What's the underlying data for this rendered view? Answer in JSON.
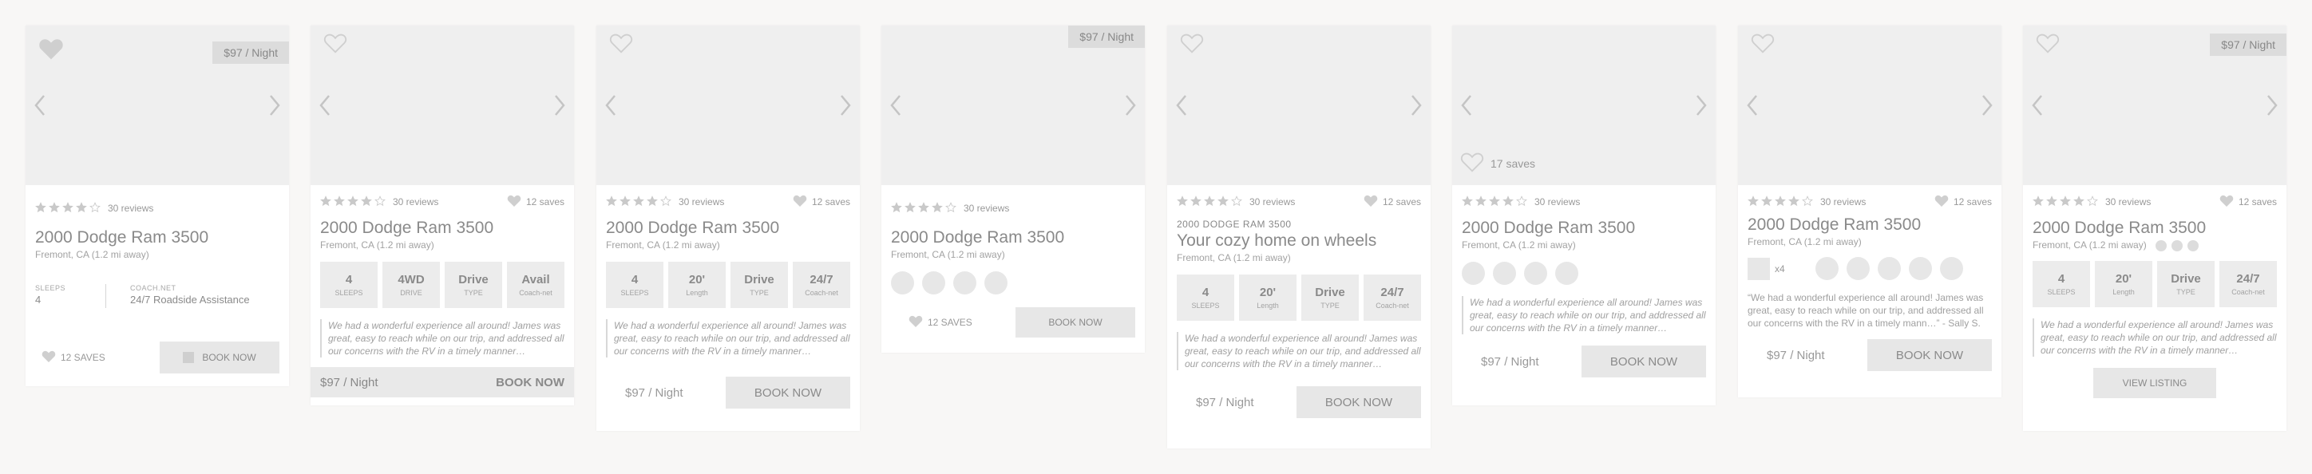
{
  "listing": {
    "price_tag": "$97 / Night",
    "reviews": "30 reviews",
    "saves": "12 saves",
    "photo_saves": "17 saves",
    "title": "2000 Dodge Ram 3500",
    "location": "Fremont, CA (1.2 mi away)",
    "eyebrow": "2000 DODGE RAM 3500",
    "cozy_title": "Your cozy home on wheels",
    "review": "We had a wonderful experience all around! James was great, easy to reach while on our trip, and addressed all our concerns with the RV in a timely manner…",
    "review_quoted": "“We had a wonderful experience all around! James was great, easy to reach while on our trip, and addressed all our concerns with the RV in a timely mann…”",
    "review_author": " - Sally S.",
    "price_text": "$97 / Night",
    "book_now": "BOOK NOW",
    "book_now_title": "Book Now",
    "saves_upper": "12 SAVES",
    "view_listing": "VIEW LISTING",
    "x4": "x4"
  },
  "card1": {
    "sleeps_label": "SLEEPS",
    "sleeps_value": "4",
    "coach_label": "COACH.NET",
    "coach_value": "24/7 Roadside Assistance"
  },
  "specs_a": [
    {
      "value": "4",
      "label": "SLEEPS"
    },
    {
      "value": "4WD",
      "label": "DRIVE"
    },
    {
      "value": "Drive",
      "label": "TYPE"
    },
    {
      "value": "Avail",
      "label": "Coach-net"
    }
  ],
  "specs_b": [
    {
      "value": "4",
      "label": "SLEEPS"
    },
    {
      "value": "20'",
      "label": "Length"
    },
    {
      "value": "Drive",
      "label": "TYPE"
    },
    {
      "value": "24/7",
      "label": "Coach-net"
    }
  ],
  "rating": {
    "stars_filled": 4,
    "stars_total": 5
  },
  "colors": {
    "background": "#f8f7f6",
    "card": "#ffffff",
    "photo": "#efefef",
    "button": "#e7e7e7",
    "text": "#8f8f8f"
  },
  "icons": [
    "heart-icon",
    "star-icon",
    "chevron-left-icon",
    "chevron-right-icon",
    "calendar-icon"
  ]
}
